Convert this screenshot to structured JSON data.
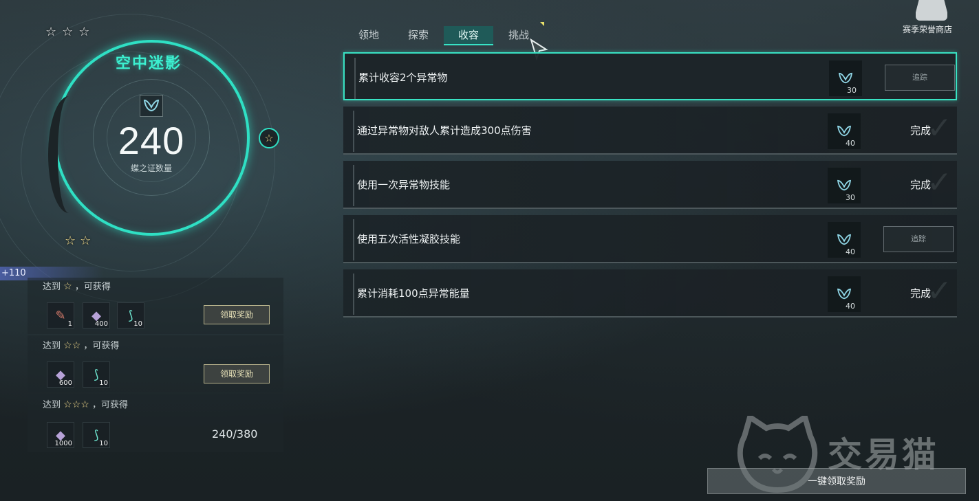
{
  "stage": {
    "title": "空中迷影",
    "count": "240",
    "count_label": "蝶之证数量",
    "stars_top": [
      "☆",
      "☆",
      "☆"
    ],
    "star_side": "☆",
    "stars_bottom": [
      "☆",
      "☆"
    ]
  },
  "bonus_tag": "+110",
  "reward_rows": [
    {
      "prefix": "达到",
      "stars": [
        "☆"
      ],
      "suffix": "，可获得",
      "items": [
        {
          "icon": "scroll-icon",
          "glyph": "✎",
          "qty": "1"
        },
        {
          "icon": "crystal-icon",
          "glyph": "◆",
          "qty": "400"
        },
        {
          "icon": "dna-icon",
          "glyph": "⟆",
          "qty": "10"
        }
      ],
      "action": "领取奖励"
    },
    {
      "prefix": "达到",
      "stars": [
        "☆",
        "☆"
      ],
      "suffix": "，可获得",
      "items": [
        {
          "icon": "crystal-icon",
          "glyph": "◆",
          "qty": "600"
        },
        {
          "icon": "dna-icon",
          "glyph": "⟆",
          "qty": "10"
        }
      ],
      "action": "领取奖励"
    },
    {
      "prefix": "达到",
      "stars": [
        "☆",
        "☆",
        "☆"
      ],
      "suffix": "，可获得",
      "items": [
        {
          "icon": "crystal-icon",
          "glyph": "◆",
          "qty": "1000"
        },
        {
          "icon": "dna-icon",
          "glyph": "⟆",
          "qty": "10"
        }
      ],
      "progress": "240/380"
    }
  ],
  "tabs": [
    {
      "label": "领地",
      "active": false
    },
    {
      "label": "探索",
      "active": false
    },
    {
      "label": "收容",
      "active": true
    },
    {
      "label": "挑战",
      "active": false
    }
  ],
  "tasks": [
    {
      "title": "累计收容2个异常物",
      "reward": "30",
      "status": "track",
      "status_label": "追踪",
      "selected": true
    },
    {
      "title": "通过异常物对敌人累计造成300点伤害",
      "reward": "40",
      "status": "done",
      "status_label": "完成",
      "selected": false
    },
    {
      "title": "使用一次异常物技能",
      "reward": "30",
      "status": "done",
      "status_label": "完成",
      "selected": false
    },
    {
      "title": "使用五次活性凝胶技能",
      "reward": "40",
      "status": "track",
      "status_label": "追踪",
      "selected": false
    },
    {
      "title": "累计消耗100点异常能量",
      "reward": "40",
      "status": "done",
      "status_label": "完成",
      "selected": false
    }
  ],
  "shop": {
    "label": "赛季荣誉商店"
  },
  "claim_all": "一键领取奖励",
  "watermark": "交易猫",
  "colors": {
    "accent": "#2fe0c4",
    "star": "#f0d98a",
    "tab_active": "#1f5a58"
  }
}
